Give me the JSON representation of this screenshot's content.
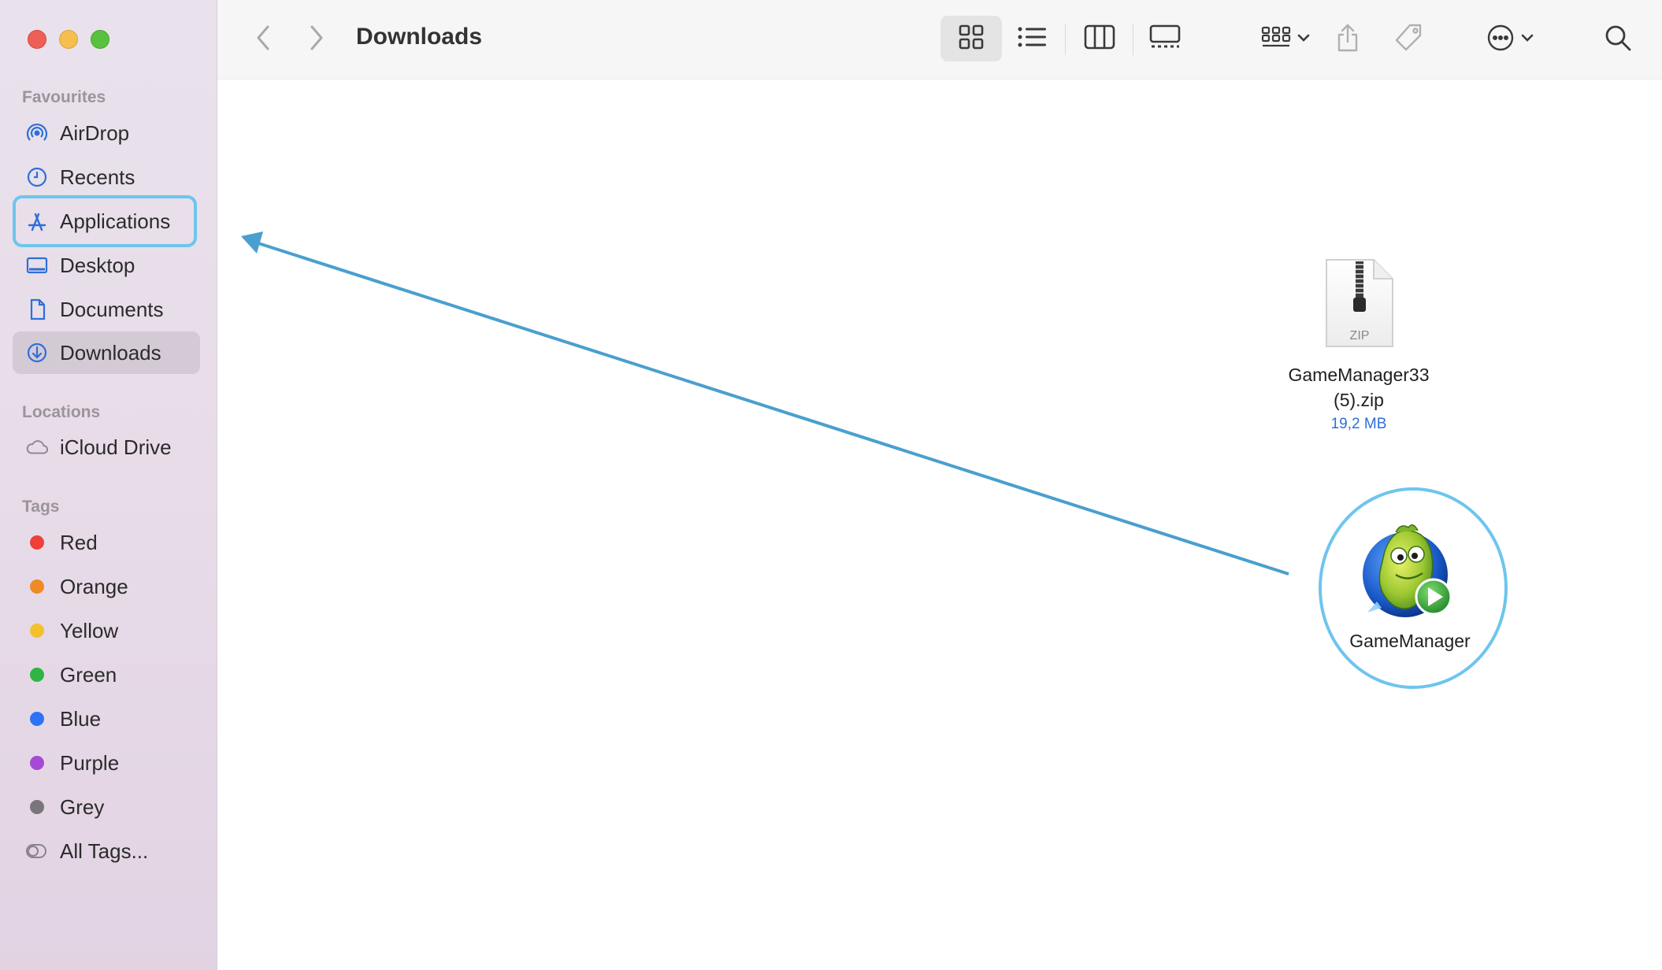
{
  "window": {
    "title": "Downloads"
  },
  "sidebar": {
    "favourites_label": "Favourites",
    "favourites": [
      {
        "label": "AirDrop",
        "icon": "airdrop-icon"
      },
      {
        "label": "Recents",
        "icon": "clock-icon"
      },
      {
        "label": "Applications",
        "icon": "applications-icon"
      },
      {
        "label": "Desktop",
        "icon": "desktop-icon"
      },
      {
        "label": "Documents",
        "icon": "document-icon"
      },
      {
        "label": "Downloads",
        "icon": "download-icon"
      }
    ],
    "locations_label": "Locations",
    "locations": [
      {
        "label": "iCloud Drive",
        "icon": "cloud-icon"
      }
    ],
    "tags_label": "Tags",
    "tags": [
      {
        "label": "Red",
        "color": "#f0403a"
      },
      {
        "label": "Orange",
        "color": "#f08a24"
      },
      {
        "label": "Yellow",
        "color": "#f2c12e"
      },
      {
        "label": "Green",
        "color": "#2fb543"
      },
      {
        "label": "Blue",
        "color": "#2c74f5"
      },
      {
        "label": "Purple",
        "color": "#a54ad6"
      },
      {
        "label": "Grey",
        "color": "#7a757c"
      },
      {
        "label": "All Tags...",
        "icon": "all-tags-icon"
      }
    ]
  },
  "files": [
    {
      "name_line1": "GameManager33",
      "name_line2": "(5).zip",
      "size": "19,2 MB",
      "icon_label": "ZIP"
    },
    {
      "name_line1": "GameManager"
    }
  ],
  "colors": {
    "accent": "#2d6fd8",
    "highlight_ring": "#6ec5ee",
    "arrow": "#4a9fcf"
  }
}
